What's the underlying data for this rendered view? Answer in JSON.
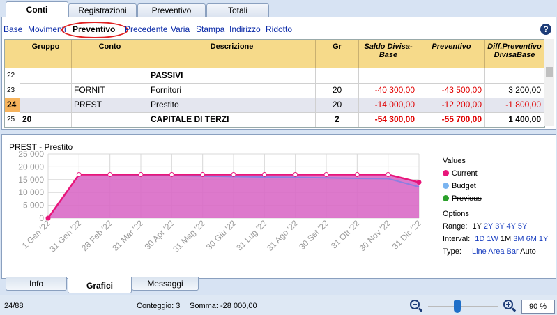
{
  "tabs": [
    "Conti",
    "Registrazioni",
    "Preventivo",
    "Totali"
  ],
  "subnav": [
    "Base",
    "Movimenti",
    "Preventivo",
    "Precedente",
    "Varia",
    "Stampa",
    "Indirizzo",
    "Ridotto"
  ],
  "help": "?",
  "table": {
    "headers": [
      "Gruppo",
      "Conto",
      "Descrizione",
      "Gr",
      "Saldo Divisa-Base",
      "Preventivo",
      "Diff.Preventivo DivisaBase"
    ],
    "rows": [
      {
        "n": "22",
        "gruppo": "",
        "conto": "",
        "desc": "PASSIVI",
        "gr": "",
        "saldo": "",
        "prev": "",
        "diff": ""
      },
      {
        "n": "23",
        "gruppo": "",
        "conto": "FORNIT",
        "desc": "Fornitori",
        "gr": "20",
        "saldo": "-40 300,00",
        "prev": "-43 500,00",
        "diff": "3 200,00"
      },
      {
        "n": "24",
        "gruppo": "",
        "conto": "PREST",
        "desc": "Prestito",
        "gr": "20",
        "saldo": "-14 000,00",
        "prev": "-12 200,00",
        "diff": "-1 800,00"
      },
      {
        "n": "25",
        "gruppo": "20",
        "conto": "",
        "desc": "CAPITALE DI TERZI",
        "gr": "2",
        "saldo": "-54 300,00",
        "prev": "-55 700,00",
        "diff": "1 400,00"
      }
    ]
  },
  "chart_title": "PREST - Prestito",
  "chart_data": {
    "type": "area",
    "title": "PREST - Prestito",
    "categories": [
      "1 Gen '22",
      "31 Gen '22",
      "28 Feb '22",
      "31 Mar '22",
      "30 Apr '22",
      "31 Mag '22",
      "30 Giu '22",
      "31 Lug '22",
      "31 Ago '22",
      "30 Set '22",
      "31 Ott '22",
      "30 Nov '22",
      "31 Dic '22"
    ],
    "series": [
      {
        "name": "Current",
        "color": "#e8157a",
        "values": [
          0,
          17000,
          17000,
          17000,
          17000,
          17000,
          17000,
          17000,
          17000,
          17000,
          17000,
          17000,
          14000
        ]
      },
      {
        "name": "Budget",
        "color": "#7ab4f0",
        "values": [
          0,
          17000,
          16900,
          16700,
          16600,
          16400,
          16200,
          16000,
          15900,
          15700,
          15500,
          15400,
          12200
        ]
      },
      {
        "name": "Previous",
        "color": "#2aa02a",
        "values": []
      }
    ],
    "ylim": [
      0,
      25000
    ],
    "yticks": [
      "0",
      "5 000",
      "10 000",
      "15 000",
      "20 000",
      "25 000"
    ],
    "grid": true
  },
  "legend": {
    "values_label": "Values",
    "items": [
      "Current",
      "Budget",
      "Previous"
    ],
    "options_label": "Options",
    "range_label": "Range:",
    "range": [
      "1Y",
      "2Y",
      "3Y",
      "4Y",
      "5Y"
    ],
    "interval_label": "Interval:",
    "interval": [
      "1D",
      "1W",
      "1M",
      "3M",
      "6M",
      "1Y"
    ],
    "type_label": "Type:",
    "type": [
      "Line",
      "Area",
      "Bar",
      "Auto"
    ]
  },
  "bottom_tabs": [
    "Info",
    "Grafici",
    "Messaggi"
  ],
  "status": {
    "position": "24/88",
    "count": "Conteggio: 3",
    "sum": "Somma: -28 000,00",
    "zoom": "90  %"
  }
}
